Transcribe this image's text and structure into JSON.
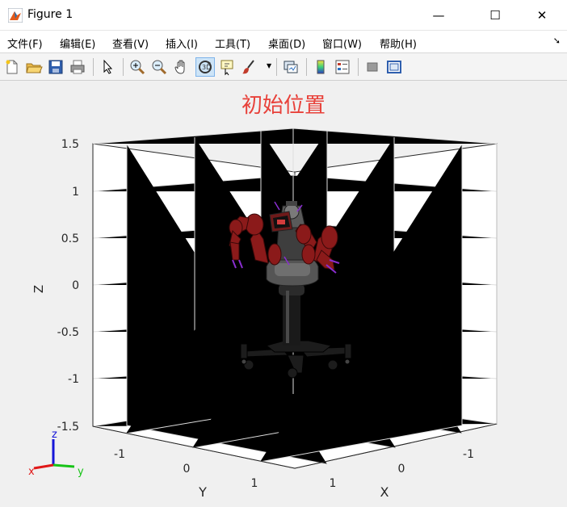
{
  "window": {
    "title": "Figure 1",
    "minimize": "—",
    "maximize": "☐",
    "close": "✕"
  },
  "menu": [
    "文件(F)",
    "编辑(E)",
    "查看(V)",
    "插入(I)",
    "工具(T)",
    "桌面(D)",
    "窗口(W)",
    "帮助(H)"
  ],
  "toolbar": [
    "new-figure",
    "open-file",
    "save",
    "print",
    "edit-plot",
    "zoom-in",
    "zoom-out",
    "pan",
    "rotate-3d",
    "data-cursor",
    "brush",
    "link-plot",
    "insert-colorbar",
    "insert-legend",
    "hide-plot-tools",
    "show-plot-tools"
  ],
  "plot": {
    "title": "初始位置",
    "zlabel": "Z",
    "ylabel": "Y",
    "xlabel": "X",
    "z_ticks": [
      "1.5",
      "1",
      "0.5",
      "0",
      "-0.5",
      "-1",
      "-1.5"
    ],
    "y_ticks": [
      "-1",
      "0",
      "1"
    ],
    "x_ticks": [
      "1",
      "0",
      "-1"
    ],
    "triad": {
      "z": "z",
      "x": "x",
      "y": "y"
    }
  },
  "colors": {
    "title": "#e8413a",
    "robot_arm": "#8b1a1a",
    "robot_body": "#333333"
  }
}
